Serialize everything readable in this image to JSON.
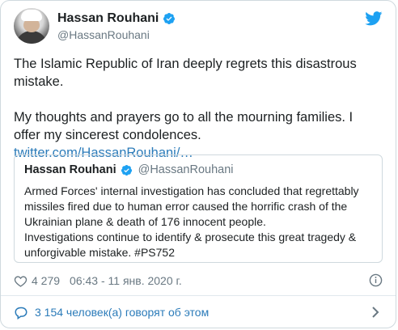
{
  "header": {
    "name": "Hassan Rouhani",
    "handle": "@HassanRouhani",
    "verified_icon": "verified-badge-icon",
    "logo_icon": "twitter-bird-icon"
  },
  "tweet": {
    "paragraph1": "The Islamic Republic of Iran deeply regrets this disastrous mistake.",
    "paragraph2": "My thoughts and prayers go to all the mourning families. I offer my sincerest condolences.",
    "link": "twitter.com/HassanRouhani/…"
  },
  "quote": {
    "name": "Hassan Rouhani",
    "handle": "@HassanRouhani",
    "text1": "Armed Forces' internal investigation has concluded that regrettably missiles fired due to human error caused the horrific crash of the Ukrainian plane & death of 176 innocent people.",
    "text2": "Investigations continue to identify & prosecute this great tragedy & unforgivable mistake. #PS752"
  },
  "meta": {
    "likes": "4 279",
    "timestamp": "06:43 - 11 янв. 2020 г."
  },
  "footer": {
    "text": "3 154 человек(а) говорят об этом"
  },
  "colors": {
    "link": "#2b7bb9",
    "verified": "#1da1f2",
    "secondary_text": "#697882"
  }
}
